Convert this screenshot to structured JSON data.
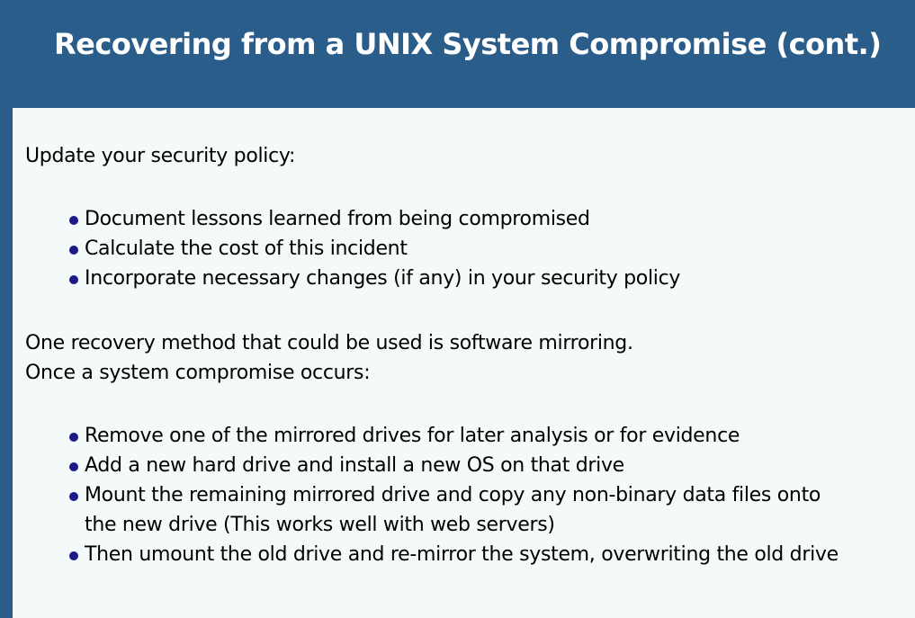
{
  "slide": {
    "title": "Recovering from a UNIX System Compromise (cont.)",
    "intro": "Update your security policy:",
    "policy_items": [
      "Document lessons learned from being compromised",
      "Calculate the cost of this incident",
      "Incorporate necessary changes (if any) in your security policy"
    ],
    "method_line1": "One recovery method that could be used is software mirroring.",
    "method_line2": "Once a system compromise occurs:",
    "mirror_items": [
      "Remove one of the mirrored drives for later analysis or for evidence",
      "Add a new hard drive and install a new OS on that drive",
      "Mount the remaining mirrored drive and copy any non-binary data files onto",
      "the new drive (This works well with web servers)",
      "Then umount the old drive and re-mirror the system, overwriting the old drive"
    ]
  },
  "colors": {
    "header_bg": "#2a5d8a",
    "content_bg": "#f4f9fa",
    "bullet": "#1a1a8a",
    "title_text": "#ffffff"
  }
}
